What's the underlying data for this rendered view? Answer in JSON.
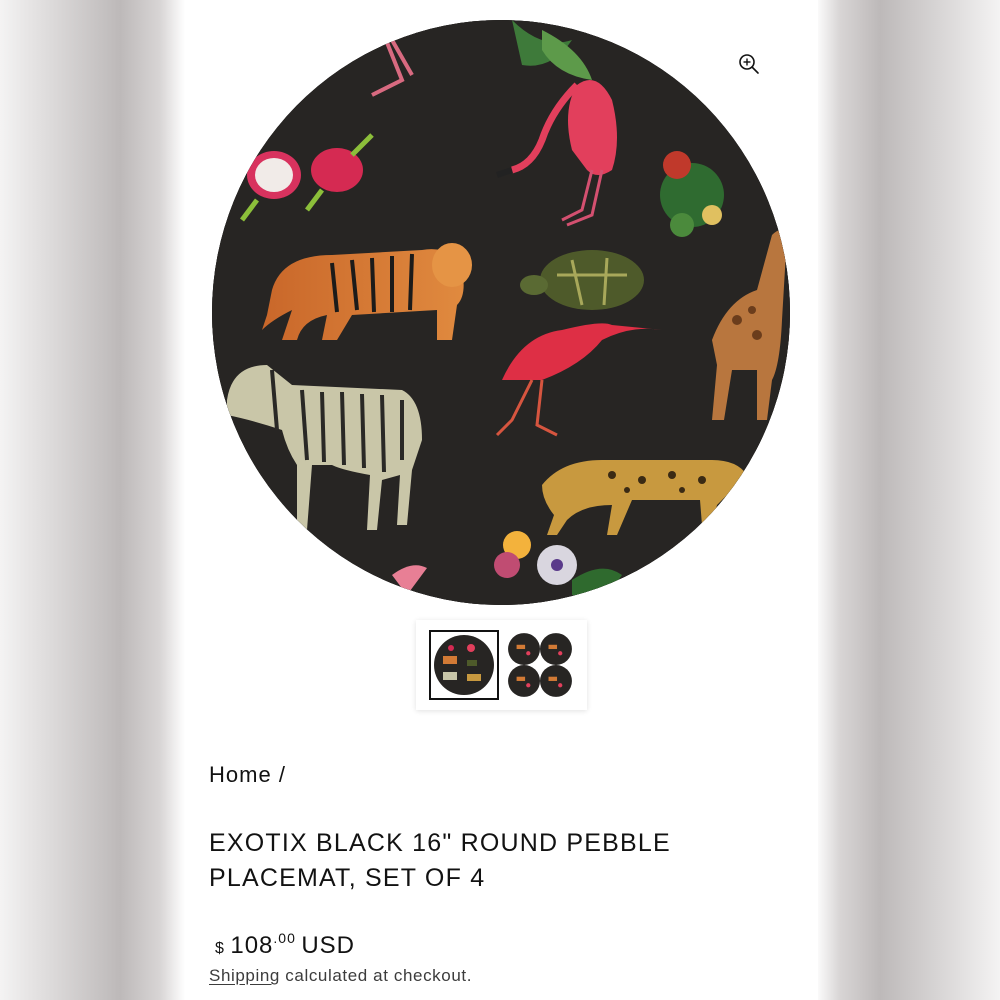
{
  "product": {
    "image_alt": "Exotix Black 16\" Round Pebble Placemat",
    "zoom_icon": "zoom-in-icon",
    "thumbnails": [
      {
        "alt": "Single placemat view",
        "selected": true
      },
      {
        "alt": "Set of 4 placemats view",
        "selected": false
      }
    ],
    "breadcrumb": {
      "home": "Home",
      "separator": "/"
    },
    "title": "EXOTIX BLACK 16\" ROUND PEBBLE PLACEMAT, SET OF 4",
    "price": {
      "symbol": "$",
      "amount": "108",
      "cents": ".00",
      "currency": "USD"
    },
    "shipping": {
      "link_text": "Shipping",
      "text": "calculated at checkout."
    }
  },
  "colors": {
    "placemat": "#272523",
    "text": "#121212",
    "background": "#ffffff"
  }
}
